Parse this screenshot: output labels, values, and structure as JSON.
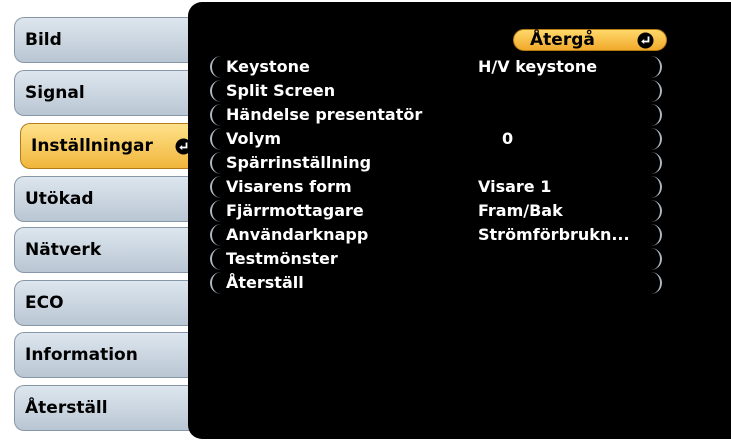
{
  "tabs": [
    {
      "label": "Bild"
    },
    {
      "label": "Signal"
    },
    {
      "label": "Inställningar"
    },
    {
      "label": "Utökad"
    },
    {
      "label": "Nätverk"
    },
    {
      "label": "ECO"
    },
    {
      "label": "Information"
    },
    {
      "label": "Återställ"
    }
  ],
  "active_tab": "Inställningar",
  "back_button": {
    "label": "Återgå"
  },
  "items": [
    {
      "label": "Keystone",
      "value": "H/V keystone"
    },
    {
      "label": "Split Screen",
      "value": ""
    },
    {
      "label": "Händelse presentatör",
      "value": ""
    },
    {
      "label": "Volym",
      "value": "0"
    },
    {
      "label": "Spärrinställning",
      "value": ""
    },
    {
      "label": "Visarens form",
      "value": "Visare 1"
    },
    {
      "label": "Fjärrmottagare",
      "value": "Fram/Bak"
    },
    {
      "label": "Användarknapp",
      "value": "Strömförbrukn..."
    },
    {
      "label": "Testmönster",
      "value": ""
    },
    {
      "label": "Återställ",
      "value": ""
    }
  ],
  "colors": {
    "tab_inactive": "#cfd9e3",
    "tab_active": "#f6c64f",
    "back_button": "#f6c24a",
    "panel": "#000000",
    "item_border": "#aeb8c2"
  },
  "icons": {
    "enter": "enter-arrow-icon"
  }
}
